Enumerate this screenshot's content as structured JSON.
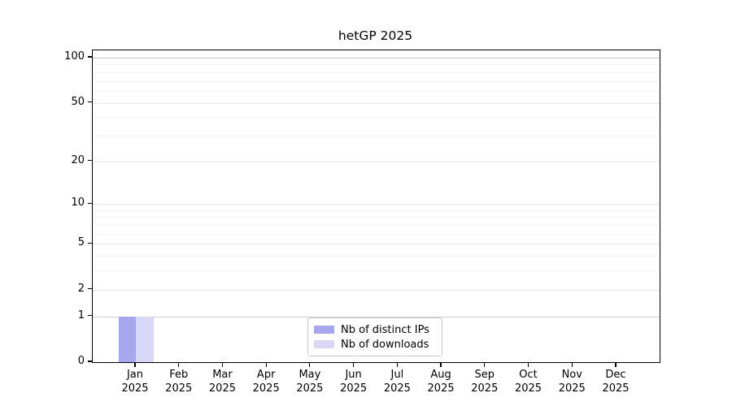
{
  "chart_data": {
    "type": "bar",
    "title": "hetGP 2025",
    "categories": [
      "Jan",
      "Feb",
      "Mar",
      "Apr",
      "May",
      "Jun",
      "Jul",
      "Aug",
      "Sep",
      "Oct",
      "Nov",
      "Dec"
    ],
    "x_year": "2025",
    "series": [
      {
        "name": "Nb of distinct IPs",
        "color": "#a7a7f0",
        "values": [
          1,
          0,
          0,
          0,
          0,
          0,
          0,
          0,
          0,
          0,
          0,
          0
        ]
      },
      {
        "name": "Nb of downloads",
        "color": "#d9d9f7",
        "values": [
          1,
          0,
          0,
          0,
          0,
          0,
          0,
          0,
          0,
          0,
          0,
          0
        ]
      }
    ],
    "y_scale": "log1p",
    "y_axis": {
      "major_ticks": [
        0,
        1,
        2,
        5,
        10,
        20,
        50,
        100
      ],
      "minor_gridlines": [
        3,
        4,
        6,
        7,
        8,
        9,
        30,
        40,
        60,
        70,
        80,
        90
      ],
      "top_value": 113
    },
    "grid": "horizontal",
    "legend_position": "lower-center",
    "colors": {
      "axis": "#000000",
      "grid_major": "#e9e9e9",
      "grid_minor": "#f3f3f3",
      "grid_line_100": "#c6c6c6",
      "grid_line_1": "#cfcfcf",
      "legend_border": "#c9c9c9",
      "text": "#000000"
    }
  }
}
